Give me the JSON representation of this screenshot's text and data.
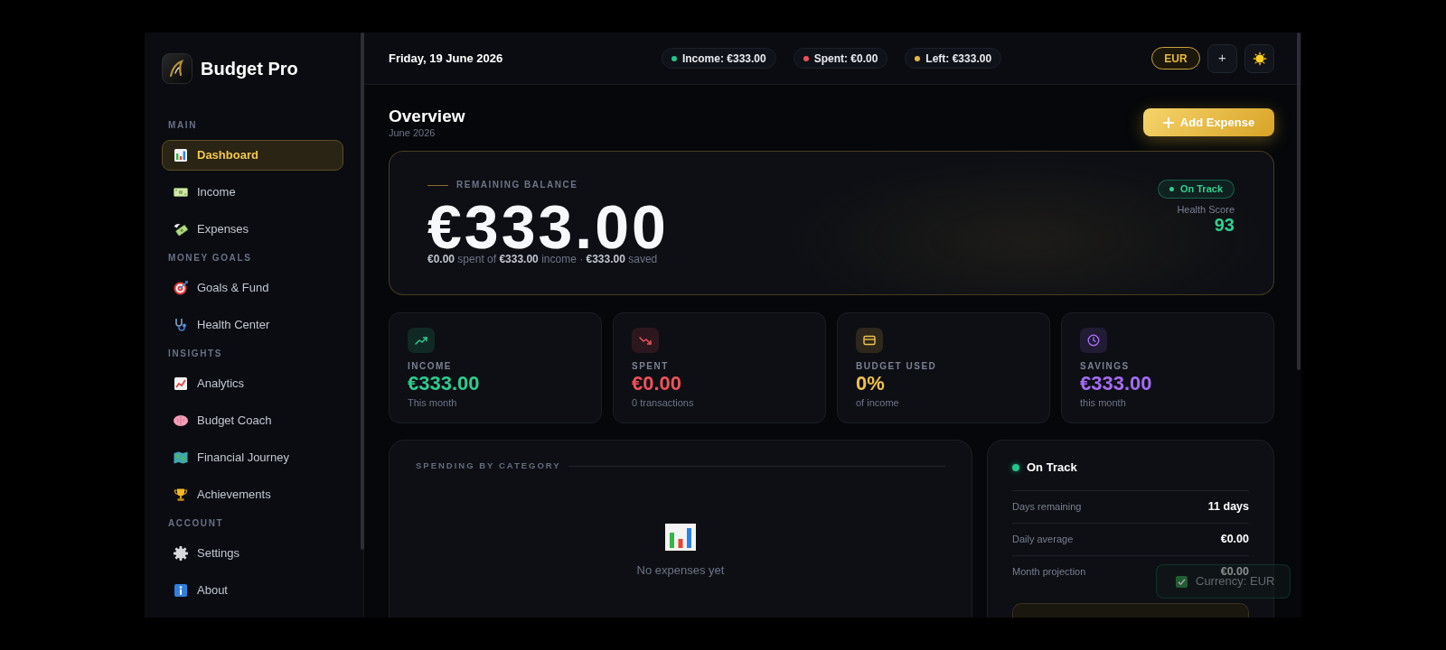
{
  "sidebar": {
    "app_name": "Budget Pro",
    "sections": [
      {
        "title": "MAIN",
        "items": [
          {
            "label": "Dashboard",
            "selected": true
          },
          {
            "label": "Income",
            "selected": false
          },
          {
            "label": "Expenses",
            "selected": false
          }
        ]
      },
      {
        "title": "MONEY GOALS",
        "items": [
          {
            "label": "Goals & Fund",
            "selected": false
          },
          {
            "label": "Health Center",
            "selected": false
          }
        ]
      },
      {
        "title": "INSIGHTS",
        "items": [
          {
            "label": "Analytics",
            "selected": false
          },
          {
            "label": "Budget Coach",
            "selected": false
          },
          {
            "label": "Financial Journey",
            "selected": false
          },
          {
            "label": "Achievements",
            "selected": false
          }
        ]
      },
      {
        "title": "ACCOUNT",
        "items": [
          {
            "label": "Settings",
            "selected": false
          },
          {
            "label": "About",
            "selected": false
          }
        ]
      }
    ]
  },
  "topbar": {
    "date": "Friday, 19 June 2026",
    "pills": [
      {
        "label": "Income: €333.00",
        "color": "#22c58b"
      },
      {
        "label": "Spent: €0.00",
        "color": "#f0505a"
      },
      {
        "label": "Left: €333.00",
        "color": "#e8b640"
      }
    ],
    "currency": "EUR",
    "add_button": "+"
  },
  "overview": {
    "title": "Overview",
    "subtitle": "June 2026",
    "add_button": "Add Expense"
  },
  "balance_card": {
    "label": "REMAINING BALANCE",
    "amount": "€333.00",
    "summary": "**€0.00** spent of **€333.00** income · **€333.00** saved",
    "status": "On Track",
    "score_label": "Health Score",
    "score": "93"
  },
  "stats": [
    {
      "label": "INCOME",
      "value": "€333.00",
      "note": "This month",
      "color": "#2ecc8f"
    },
    {
      "label": "SPENT",
      "value": "€0.00",
      "note": "0 transactions",
      "color": "#f0515a"
    },
    {
      "label": "BUDGET USED",
      "value": "0%",
      "note": "of income",
      "color": "#f0c14b"
    },
    {
      "label": "SAVINGS",
      "value": "€333.00",
      "note": "this month",
      "color": "#a66cf5"
    }
  ],
  "category_card": {
    "title": "SPENDING BY CATEGORY",
    "empty_text": "No expenses yet"
  },
  "status_card": {
    "status": "On Track",
    "rows": [
      {
        "label": "Days remaining",
        "value": "11 days"
      },
      {
        "label": "Daily average",
        "value": "€0.00"
      },
      {
        "label": "Month projection",
        "value": "€0.00"
      }
    ]
  },
  "toast": {
    "text": "Currency: EUR"
  }
}
